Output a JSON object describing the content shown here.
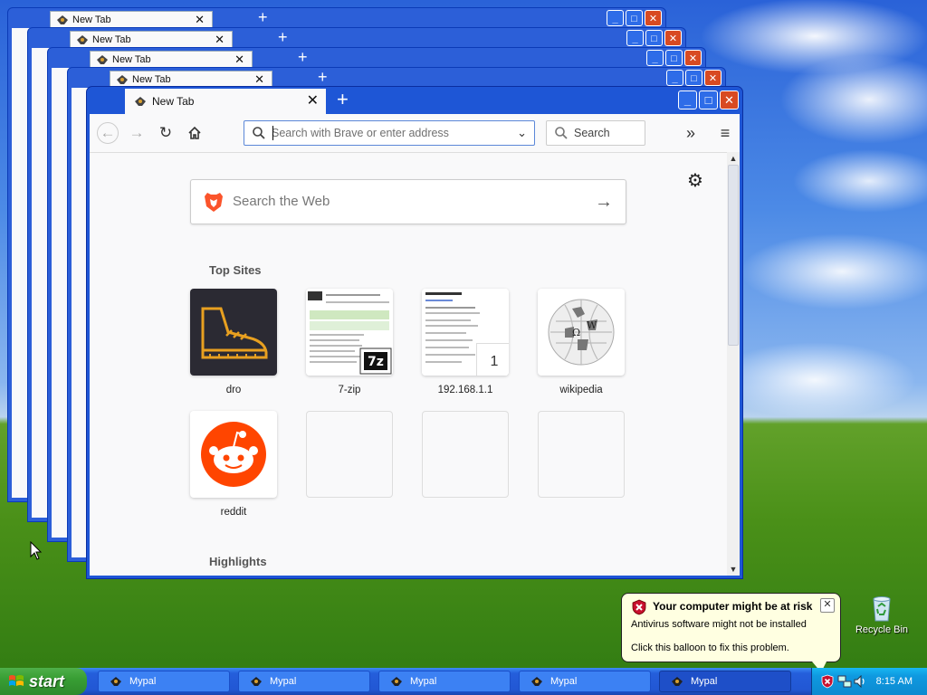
{
  "background_windows": {
    "tab_label": "New Tab"
  },
  "browser": {
    "tab": {
      "label": "New Tab"
    },
    "urlbar": {
      "placeholder": "Search with Brave or enter address"
    },
    "searchbar": {
      "placeholder": "Search"
    },
    "page": {
      "websearch_placeholder": "Search the Web",
      "top_sites_title": "Top Sites",
      "highlights_title": "Highlights",
      "top_sites": [
        {
          "label": "dro"
        },
        {
          "label": "7-zip"
        },
        {
          "label": "192.168.1.1",
          "badge": "1"
        },
        {
          "label": "wikipedia"
        },
        {
          "label": "reddit"
        }
      ]
    }
  },
  "balloon": {
    "title": "Your computer might be at risk",
    "line1": "Antivirus software might not be installed",
    "line2": "Click this balloon to fix this problem."
  },
  "desktop": {
    "recycle_bin_label": "Recycle Bin"
  },
  "taskbar": {
    "start_label": "start",
    "buttons": [
      {
        "label": "Mypal"
      },
      {
        "label": "Mypal"
      },
      {
        "label": "Mypal"
      },
      {
        "label": "Mypal"
      },
      {
        "label": "Mypal"
      }
    ],
    "clock": "8:15 AM"
  },
  "colors": {
    "titlebar_blue": "#1e56d6",
    "start_green": "#389e34",
    "close_red": "#d84a22",
    "reddit_orange": "#ff4500",
    "balloon_yellow": "#ffffe1"
  }
}
